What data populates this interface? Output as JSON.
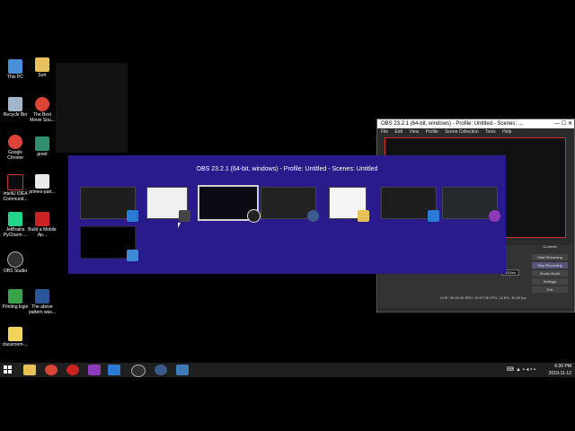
{
  "desktop_icons": [
    {
      "label": "This PC",
      "color": "#4a8fd8"
    },
    {
      "label": "Sort",
      "color": "#e8c15a"
    },
    {
      "label": "Recycle Bin",
      "color": "#9fb7c8"
    },
    {
      "label": "The Best Movie Sou...",
      "color": "#db4437"
    },
    {
      "label": "Google Chrome",
      "color": "#db4437"
    },
    {
      "label": "greet",
      "color": "#2f8f6f"
    },
    {
      "label": "IntelliJ IDEA Communit...",
      "color": "#0b0b0b"
    },
    {
      "label": "primes-part...",
      "color": "#eaeaea"
    },
    {
      "label": "JetBrains PyCharm ...",
      "color": "#21d789"
    },
    {
      "label": "Build a Mobile Ap...",
      "color": "#cc2222"
    },
    {
      "label": "OBS Studio",
      "color": "#303030"
    },
    {
      "label": "Printing login",
      "color": "#3aa24a"
    },
    {
      "label": "The above pattern was...",
      "color": "#2b579a"
    },
    {
      "label": "classroom-...",
      "color": "#f2d45c"
    }
  ],
  "obs_window": {
    "title": "OBS 23.2.1 (64-bit, windows) - Profile: Untitled - Scenes: ...",
    "window_controls": "—  ☐  ✕",
    "menu": [
      "File",
      "Edit",
      "View",
      "Profile",
      "Scene Collection",
      "Tools",
      "Help"
    ],
    "controls_header": "Controls",
    "buttons": [
      "Start Streaming",
      "Stop Recording",
      "Studio Mode",
      "Settings",
      "Exit"
    ],
    "duration_label": "Duration",
    "duration_value": "300ms",
    "status": "LIVE: 00:00:00   REC: 00:07:08   CPU: 22.8%, 30.00 fps"
  },
  "switcher": {
    "title": "OBS 23.2.1 (64-bit, windows) - Profile: Untitled - Scenes: Untitled",
    "thumbnails": [
      {
        "name": "vscode-window",
        "badge_icon": "vscode-icon",
        "badge_color": "#2a7bd6",
        "bg": "#1e1e1e"
      },
      {
        "name": "browser-window",
        "badge_icon": "pen-icon",
        "badge_color": "#444444",
        "bg": "#f0f0f0"
      },
      {
        "name": "obs-window",
        "badge_icon": "obs-icon",
        "badge_color": "#222222",
        "bg": "#0b0b14"
      },
      {
        "name": "terminal-window",
        "badge_icon": "inkscape-icon",
        "badge_color": "#3b5b8a",
        "bg": "#222222"
      },
      {
        "name": "file-explorer-window",
        "badge_icon": "folder-icon",
        "badge_color": "#e8c15a",
        "bg": "#f4f4f4"
      },
      {
        "name": "vscode-window-2",
        "badge_icon": "vscode-icon",
        "badge_color": "#2a7bd6",
        "bg": "#1e1e1e"
      },
      {
        "name": "github-desktop-window",
        "badge_icon": "github-icon",
        "badge_color": "#8f3bb8",
        "bg": "#24292e"
      },
      {
        "name": "blank-window",
        "badge_icon": "window-icon",
        "badge_color": "#3c8ad8",
        "bg": "#000000"
      }
    ]
  },
  "taskbar": {
    "items": [
      {
        "icon": "file-explorer-icon",
        "color": "#e8c15a"
      },
      {
        "icon": "chrome-icon",
        "color": "#db4437"
      },
      {
        "icon": "git-icon",
        "color": "#cc2222"
      },
      {
        "icon": "github-icon",
        "color": "#8f3bb8"
      },
      {
        "icon": "vscode-icon",
        "color": "#2a7bd6"
      },
      {
        "icon": "obs-icon",
        "color": "#303030"
      },
      {
        "icon": "inkscape-icon",
        "color": "#3b5b8a"
      },
      {
        "icon": "python-icon",
        "color": "#3e7ab8"
      }
    ],
    "time": "6:30 PM",
    "date": "2019-11-12"
  }
}
